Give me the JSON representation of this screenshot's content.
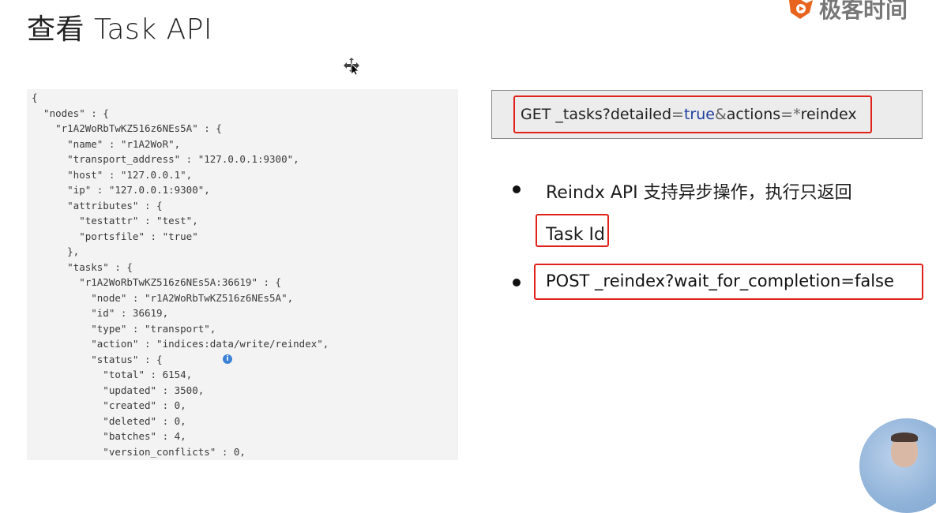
{
  "slide": {
    "title": "查看 Task API",
    "logo_text": "极客时间"
  },
  "code_panel": {
    "lines": [
      "{",
      "  \"nodes\" : {",
      "    \"r1A2WoRbTwKZ516z6NEs5A\" : {",
      "      \"name\" : \"r1A2WoR\",",
      "      \"transport_address\" : \"127.0.0.1:9300\",",
      "      \"host\" : \"127.0.0.1\",",
      "      \"ip\" : \"127.0.0.1:9300\",",
      "      \"attributes\" : {",
      "        \"testattr\" : \"test\",",
      "        \"portsfile\" : \"true\"",
      "      },",
      "      \"tasks\" : {",
      "        \"r1A2WoRbTwKZ516z6NEs5A:36619\" : {",
      "          \"node\" : \"r1A2WoRbTwKZ516z6NEs5A\",",
      "          \"id\" : 36619,",
      "          \"type\" : \"transport\",",
      "          \"action\" : \"indices:data/write/reindex\",",
      "          \"status\" : {",
      "            \"total\" : 6154,",
      "            \"updated\" : 3500,",
      "            \"created\" : 0,",
      "            \"deleted\" : 0,",
      "            \"batches\" : 4,",
      "            \"version_conflicts\" : 0,"
    ]
  },
  "command": {
    "method": "GET",
    "path": " _tasks?detailed",
    "eq1": "=",
    "detailed_value": "true",
    "amp": "&",
    "param2": "actions",
    "eq2": "=",
    "star": "*",
    "action_value": "reindex"
  },
  "bullets": [
    {
      "text": "Reindx API 支持异步操作，执行只返回"
    },
    {
      "text": "Task Id"
    },
    {
      "text": "POST _reindex?wait_for_completion=false"
    }
  ],
  "colors": {
    "highlight_red": "#e0221a",
    "code_bg": "#f3f3f3",
    "command_bg": "#ececec"
  }
}
